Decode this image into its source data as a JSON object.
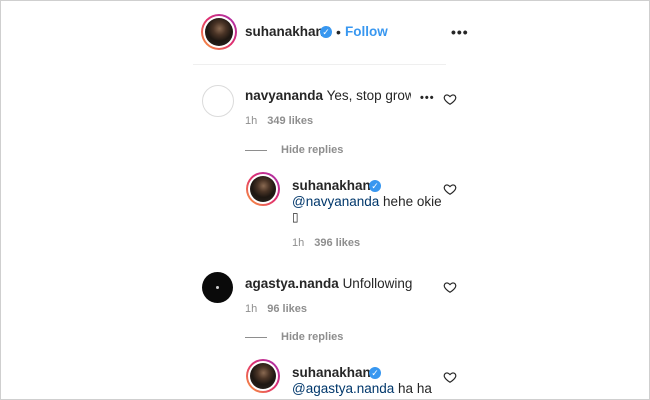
{
  "post_header": {
    "username": "suhanakhan2",
    "dot": "•",
    "follow_label": "Follow",
    "more_label": "•••"
  },
  "comments": [
    {
      "username": "navyananda",
      "text": "Yes, stop growing",
      "time": "1h",
      "likes": "349 likes",
      "more_label": "•••",
      "hide_replies": "Hide replies",
      "reply": {
        "username": "suhanakhan2",
        "mention": "@navyananda",
        "text": "hehe okie",
        "emoji": "▯",
        "time": "1h",
        "likes": "396 likes"
      }
    },
    {
      "username": "agastya.nanda",
      "text": "Unfollowing",
      "time": "1h",
      "likes": "96 likes",
      "hide_replies": "Hide replies",
      "reply": {
        "username": "suhanakhan2",
        "mention": "@agastya.nanda",
        "text": "ha ha"
      }
    }
  ],
  "icons": {
    "verified": "verified-badge-icon",
    "heart": "heart-icon",
    "more": "more-options-icon"
  },
  "colors": {
    "accent_blue": "#3897f0",
    "mention_blue": "#00376b",
    "muted_gray": "#8e8e8e",
    "text": "#262626"
  }
}
